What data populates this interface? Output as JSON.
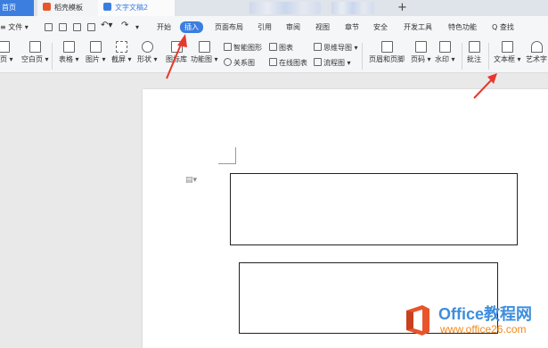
{
  "tabs": {
    "home": "首页",
    "template": "稻壳模板",
    "document": "文字文稿2",
    "new_tab": "+"
  },
  "menu": {
    "file": "≡ 文件 ▾",
    "items": [
      "开始",
      "插入",
      "页面布局",
      "引用",
      "审阅",
      "视图",
      "章节",
      "安全",
      "开发工具",
      "特色功能"
    ],
    "active": "插入",
    "search": "Q 查找"
  },
  "ribbon": {
    "cover": "页 ▾",
    "blank_page": "空白页 ▾",
    "table": "表格 ▾",
    "picture": "图片 ▾",
    "screenshot": "截屏 ▾",
    "shape": "形状 ▾",
    "icon_lib": "图标库",
    "func_chart": "功能图 ▾",
    "smart_shape": "智能图形",
    "chart": "图表",
    "mind_map": "思维导图 ▾",
    "relation": "关系图",
    "online_chart": "在线图表",
    "flow_chart": "流程图 ▾",
    "header_footer": "页眉和页脚",
    "page_num": "页码 ▾",
    "watermark": "水印 ▾",
    "comment": "批注",
    "text_box": "文本框 ▾",
    "art_text": "艺术字"
  },
  "colors": {
    "accent": "#3b7ee0",
    "arrow": "#e8382c",
    "watermark_blue": "#3e8edc",
    "watermark_orange": "#f08a1c"
  },
  "watermark": {
    "brand": "Office教程网",
    "url": "www.office26.com"
  }
}
